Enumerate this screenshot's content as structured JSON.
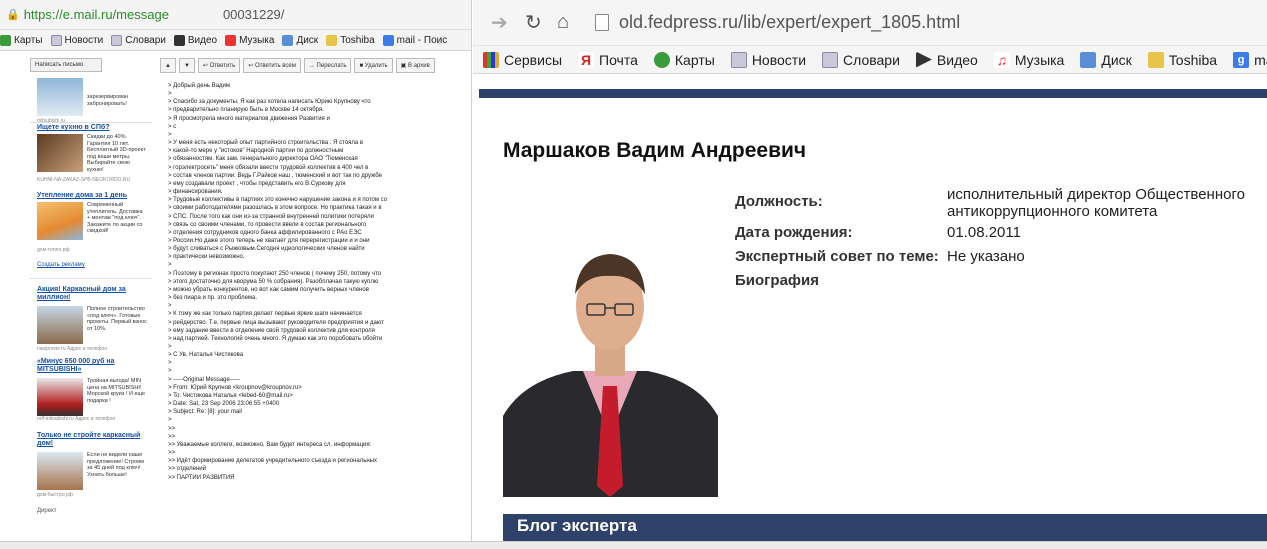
{
  "left": {
    "url": "https://e.mail.ru/message",
    "url_tail": "00031229/",
    "bookmarks": [
      "Карты",
      "Новости",
      "Словари",
      "Видео",
      "Музыка",
      "Диск",
      "Toshiba",
      "mail - Поис"
    ],
    "compose_label": "Написать письмо",
    "toolbar": [
      "Ответить",
      "Ответить всем",
      "Переслать",
      "Удалить",
      "В архив"
    ],
    "ads": [
      {
        "title": "",
        "desc": "зарезервирован заброни­ровать!",
        "domain": "mitsubishi.ru"
      },
      {
        "title": "Ищете кухню в СПб?",
        "desc": "Скидки до 40%. Гарантия 10 лет. Бесплатный 3D-проект под ваши метры. Выбирайте свою кухню!",
        "domain": "KUHNI-NA-ZAKAZ-SPB-NEOKORDO.RU"
      },
      {
        "title": "Утепление дома за 1 день",
        "desc": "Современный утеплитель. Доставка + монтаж \"под ключ\". Закажите по акции со скидкой!",
        "domain": "дом-тепло.рф"
      },
      {
        "title": "Акция! Каркасный дом за миллион!",
        "desc": "Полное строительство «под ключ». Готовые проекты. Первый взнос от 10%.",
        "domain": "nasiprovie.ru   Адрес и телефон"
      },
      {
        "title": "«Минус 650 000 руб на MITSUBISHI»",
        "desc": "Тройная выгода! MIN цена на MITSUBISHI! Морской круиз ! И еще подарки !",
        "domain": "rolf-mitsubishi.ru   Адрес и телефон"
      },
      {
        "title": "Только не стройте каркасный дом!",
        "desc": "Если не видели наше предложение! Строим за 45 дней под ключ! Узнать больше!",
        "domain": "дом-быстро.рф"
      }
    ],
    "create_ad": "Создать рекламу",
    "direct": "Директ",
    "mail_lines": [
      "> Добрый день Вадим",
      ">",
      "> Спасибо за документы. Я как раз хотела написать Юрию Крупнову что",
      "> предварительно планирую быть в Москве 14 октября.",
      "> Я просмотрела много материалов движения Развития и",
      "> с",
      ">",
      "> У меня есть некоторый опыт партийного строительства . Я стояла в",
      "> какой-то мере у \"истоков\" Народной партии по должностным",
      "> обязанностям. Как зам. генерального директора ОАО \"Тюменская",
      "> горэлектросеть\" меня обязали ввести трудовой коллектив в 400 чел в",
      "> состав членов партии. Ведь Г.Райков наш , тюменский и вот так по дружбе",
      "> ему создавали проект , чтобы представить его В.Суркову для",
      "> финансирования.",
      "> Трудовые коллективы в партиях это конечно нарушение закона и я потом со",
      "> своими работодателями разошлась в этом вопросе. Но практика такая и в",
      "> СПС. После того как они из-за странной внутренней политики потеряли",
      "> связь со своими членами, то провести ввели в состав регионального",
      "> отделения         сотрудников одного банка аффилированного с РАо ЕЭС",
      "> России.Но даже этого теперь не хватает для перерегистрации и и они",
      "> будут сливаться с Рыжковым.Сегодня идеологических членов найти",
      "> практически невозможно.",
      ">",
      "> Поэтому в регионах просто покупают 250 членов ( почему 250, потому что",
      "> этого достаточно для кворума 50 % собрания). Разобплачая такую куплю",
      "> можно убрать конкурентов, но вот как самим получить верных членов",
      "> без пиара и пр. это проблема.",
      ">",
      "> К тому же как только партия делает первые яркие шаги начинается",
      "> рейдерство. Т.е. первые лица вызывают руководителя предприятия и дают",
      "> ему задание ввести в отделение свой трудовой коллектив для контроля",
      "> над партией. Технологий очень много. Я думаю как это поробовать обойти",
      ">",
      "> С Ув. Наталья Чистякова",
      ">",
      ">",
      "> -----Original Message-----",
      "> From: Юрий Крупнов <kroupnov@kroupnov.ru>",
      "> To: Чистякова Наталья <lebed-60@mail.ru>",
      "> Date: Sat, 23 Sep 2006 23:06:55 +0400",
      "> Subject: Re: [8]: your mail",
      ">",
      ">>",
      ">>",
      ">> Уважаемые коллеги, возможно, Вам будет интереса сл. информация:",
      ">>",
      ">> Идёт формирование делегатов учредительного съезда и региональных",
      ">> отделений",
      ">> ПАРТИИ РАЗВИТИЯ"
    ]
  },
  "right": {
    "url": "old.fedpress.ru/lib/expert/expert_1805.html",
    "bookmarks": [
      "Сервисы",
      "Почта",
      "Карты",
      "Новости",
      "Словари",
      "Видео",
      "Музыка",
      "Диск",
      "Toshiba",
      "mail"
    ],
    "person_name": "Маршаков Вадим Андреевич",
    "fields": [
      {
        "label": "Должность:",
        "value": "исполнительный директор Общественного антикоррупционного комитета"
      },
      {
        "label": "Дата рождения:",
        "value": "01.08.2011"
      },
      {
        "label": "Экспертный совет по теме:",
        "value": "Не указано"
      },
      {
        "label": "Биография",
        "value": ""
      }
    ],
    "blog_title": "Блог эксперта"
  },
  "colors": {
    "navy": "#2d4169",
    "link": "#1550a8",
    "secure_green": "#2a8d2a"
  },
  "icons": {
    "back": "arrow-right-icon",
    "reload": "reload-icon",
    "home": "home-icon",
    "page": "page-icon"
  }
}
